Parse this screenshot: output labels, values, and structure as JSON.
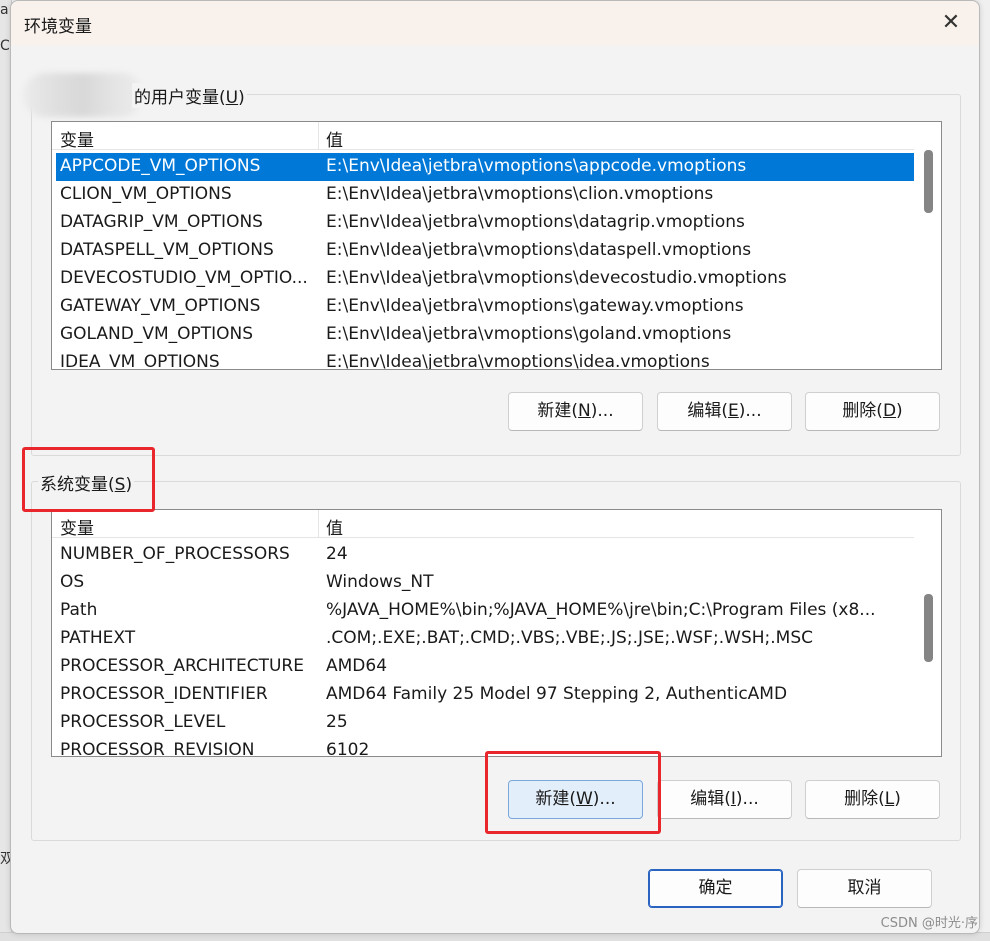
{
  "window": {
    "title": "环境变量",
    "close_glyph": "✕"
  },
  "background": {
    "glyph_a": "a",
    "glyph_c": "C",
    "glyph_x": "双"
  },
  "user_section": {
    "label_text": "的用户变量(",
    "label_key": "U",
    "label_end": ")",
    "columns": [
      "变量",
      "值"
    ],
    "rows": [
      {
        "name": "APPCODE_VM_OPTIONS",
        "value": "E:\\Env\\Idea\\jetbra\\vmoptions\\appcode.vmoptions",
        "selected": true
      },
      {
        "name": "CLION_VM_OPTIONS",
        "value": "E:\\Env\\Idea\\jetbra\\vmoptions\\clion.vmoptions"
      },
      {
        "name": "DATAGRIP_VM_OPTIONS",
        "value": "E:\\Env\\Idea\\jetbra\\vmoptions\\datagrip.vmoptions"
      },
      {
        "name": "DATASPELL_VM_OPTIONS",
        "value": "E:\\Env\\Idea\\jetbra\\vmoptions\\dataspell.vmoptions"
      },
      {
        "name": "DEVECOSTUDIO_VM_OPTIO...",
        "value": "E:\\Env\\Idea\\jetbra\\vmoptions\\devecostudio.vmoptions"
      },
      {
        "name": "GATEWAY_VM_OPTIONS",
        "value": "E:\\Env\\Idea\\jetbra\\vmoptions\\gateway.vmoptions"
      },
      {
        "name": "GOLAND_VM_OPTIONS",
        "value": "E:\\Env\\Idea\\jetbra\\vmoptions\\goland.vmoptions"
      },
      {
        "name": "IDEA_VM_OPTIONS",
        "value": "E:\\Env\\Idea\\jetbra\\vmoptions\\idea.vmoptions"
      }
    ],
    "buttons": {
      "new": {
        "pre": "新建(",
        "key": "N",
        "post": ")..."
      },
      "edit": {
        "pre": "编辑(",
        "key": "E",
        "post": ")..."
      },
      "delete": {
        "pre": "删除(",
        "key": "D",
        "post": ")"
      }
    }
  },
  "system_section": {
    "label_text": "系统变量(",
    "label_key": "S",
    "label_end": ")",
    "columns": [
      "变量",
      "值"
    ],
    "rows": [
      {
        "name": "NUMBER_OF_PROCESSORS",
        "value": "24"
      },
      {
        "name": "OS",
        "value": "Windows_NT"
      },
      {
        "name": "Path",
        "value": "%JAVA_HOME%\\bin;%JAVA_HOME%\\jre\\bin;C:\\Program Files (x8..."
      },
      {
        "name": "PATHEXT",
        "value": ".COM;.EXE;.BAT;.CMD;.VBS;.VBE;.JS;.JSE;.WSF;.WSH;.MSC"
      },
      {
        "name": "PROCESSOR_ARCHITECTURE",
        "value": "AMD64"
      },
      {
        "name": "PROCESSOR_IDENTIFIER",
        "value": "AMD64 Family 25 Model 97 Stepping 2, AuthenticAMD"
      },
      {
        "name": "PROCESSOR_LEVEL",
        "value": "25"
      },
      {
        "name": "PROCESSOR_REVISION",
        "value": "6102"
      }
    ],
    "buttons": {
      "new": {
        "pre": "新建(",
        "key": "W",
        "post": ")..."
      },
      "edit": {
        "pre": "编辑(",
        "key": "I",
        "post": ")..."
      },
      "delete": {
        "pre": "删除(",
        "key": "L",
        "post": ")"
      }
    }
  },
  "footer": {
    "ok": "确定",
    "cancel": "取消"
  },
  "watermark": "CSDN @时光·序",
  "colors": {
    "selection": "#0078d7",
    "highlight_box": "#e8262b",
    "primary_border": "#2a64c0"
  }
}
